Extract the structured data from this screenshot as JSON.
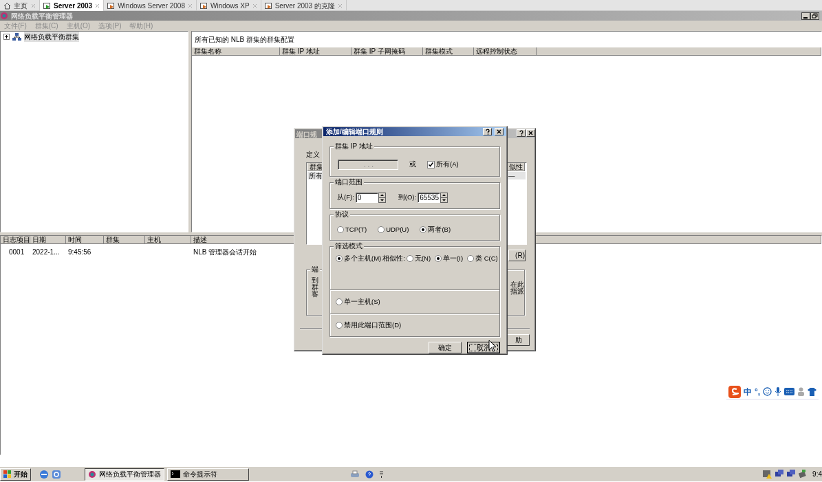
{
  "browser_tabs": [
    {
      "kind": "home",
      "label": "主页",
      "selected": false
    },
    {
      "kind": "vm",
      "label": "Server 2003",
      "selected": true
    },
    {
      "kind": "vm",
      "label": "Windows Server 2008",
      "selected": false
    },
    {
      "kind": "vm",
      "label": "Windows XP",
      "selected": false
    },
    {
      "kind": "vm",
      "label": "Server 2003 的克隆",
      "selected": false
    }
  ],
  "mmc": {
    "title": "网络负载平衡管理器",
    "menu": [
      {
        "label": "文件(F)",
        "disabled": true
      },
      {
        "label": "群集(C)",
        "disabled": true
      },
      {
        "label": "主机(O)",
        "disabled": true
      },
      {
        "label": "选项(P)",
        "disabled": true
      },
      {
        "label": "帮助(H)",
        "disabled": true
      }
    ],
    "tree": [
      {
        "label": "网络负载平衡群集",
        "expanded": false,
        "selected": true
      }
    ],
    "cluster_pane": {
      "caption": "所有已知的 NLB 群集的群集配置",
      "columns": [
        "群集名称",
        "群集 IP 地址",
        "群集 IP 子网掩码",
        "群集模式",
        "远程控制状态"
      ]
    },
    "log": {
      "columns": [
        "日志项目",
        "日期",
        "时间",
        "群集",
        "主机",
        "描述"
      ],
      "rows": [
        {
          "entry": "0001",
          "date": "2022-1...",
          "time": "9:45:56",
          "description": "NLB 管理器会话开始"
        }
      ]
    }
  },
  "back_dialog": {
    "title": "端口规",
    "intro": "定义",
    "list_header_left": "群集",
    "list_header_right": "似性",
    "row_left": "所有",
    "row_right": "—",
    "side_button": "(R)",
    "group_label": "端",
    "group_lines_left": [
      "到",
      "群",
      "客"
    ],
    "group_lines_right": [
      "在此",
      "指派"
    ],
    "help_button": "助"
  },
  "dialog": {
    "title": "添加/编辑端口规则",
    "ip_group": {
      "label": "群集 IP 地址",
      "ip_field": {
        "text": ".     .     .",
        "disabled": true
      },
      "or_label": "或",
      "all": {
        "label": "所有(A)",
        "checked": true
      }
    },
    "port_group": {
      "label": "端口范围",
      "from": {
        "label": "从(F):",
        "value": "0"
      },
      "to": {
        "label": "到(O):",
        "value": "65535"
      }
    },
    "protocol_group": {
      "label": "协议",
      "options": [
        {
          "label": "TCP(T)",
          "selected": false
        },
        {
          "label": "UDP(U)",
          "selected": false
        },
        {
          "label": "两者(B)",
          "selected": true
        }
      ]
    },
    "filter_group": {
      "label": "筛选模式",
      "modes": [
        {
          "label": "多个主机(M)",
          "selected": true,
          "affinity": {
            "label": "相似性:",
            "options": [
              {
                "label": "无(N)",
                "selected": false
              },
              {
                "label": "单一(I)",
                "selected": true
              },
              {
                "label": "类 C(C)",
                "selected": false
              }
            ]
          }
        },
        {
          "label": "单一主机(S)",
          "selected": false
        },
        {
          "label": "禁用此端口范围(D)",
          "selected": false
        }
      ]
    },
    "buttons": [
      {
        "label": "确定",
        "focused": false
      },
      {
        "label": "取消",
        "focused": true
      }
    ]
  },
  "ime": {
    "mode": "中",
    "punctuation": "°,"
  },
  "taskbar": {
    "start": "开始",
    "tasks": [
      {
        "kind": "nlb",
        "label": "网络负载平衡管理器",
        "selected": true
      },
      {
        "kind": "cmd",
        "label": "命令提示符",
        "selected": false
      }
    ],
    "clock": "9:4"
  }
}
